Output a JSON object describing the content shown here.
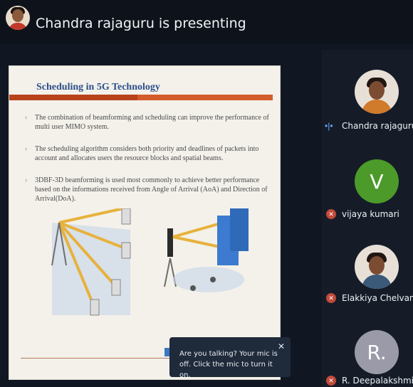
{
  "header": {
    "presenting_text": "Chandra rajaguru is presenting"
  },
  "slide": {
    "title": "Scheduling in 5G Technology",
    "bullets": [
      "The combination of beamforming and scheduling can improve the performance of multi user MIMO system.",
      "The scheduling algorithm considers both priority and deadlines of packets into account and allocates users the resource blocks and spatial beams.",
      "3DBF-3D beamforming is used most commonly to achieve better performance based on the informations received from Angle of Arrival (AoA) and Direction of Arrival(DoA)."
    ]
  },
  "participants": [
    {
      "name": "Chandra rajaguru",
      "avatar": "photo",
      "status": "speaking"
    },
    {
      "name": "vijaya kumari",
      "avatar": "V",
      "status": "muted",
      "avatar_color": "#4c9a2a"
    },
    {
      "name": "Elakkiya Chelvan",
      "avatar": "photo",
      "status": "muted"
    },
    {
      "name": "R. Deepalakshmi",
      "avatar": "R.",
      "status": "muted",
      "avatar_color": "#9a9aa8"
    }
  ],
  "toast": {
    "message": "Are you talking? Your mic is off. Click the mic to turn it on."
  },
  "icons": {
    "close": "close-icon",
    "mic_off": "mic-off-icon",
    "speaking": "speaking-indicator-icon"
  }
}
